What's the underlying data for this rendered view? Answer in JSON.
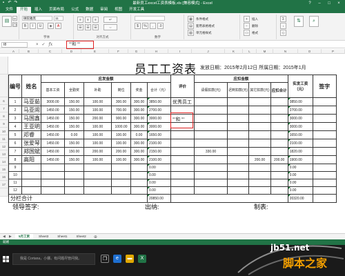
{
  "window": {
    "title": "最新员工excel工资表模板.xls [兼容模式] - Excel"
  },
  "ribbon_tabs": [
    "文件",
    "开始",
    "插入",
    "页面布局",
    "公式",
    "数据",
    "审阅",
    "视图",
    "开发工具"
  ],
  "active_tab": "开始",
  "ribbon": {
    "font_name": "微软雅黑",
    "font_size": "11",
    "group_font": "字体",
    "group_align": "对齐方式",
    "group_number": "数字",
    "group_styles": "样式",
    "group_cells": "单元格",
    "group_edit": "编辑",
    "cond_format": "条件格式",
    "table_format": "套用表格格式",
    "cell_styles": "单元格样式",
    "insert": "插入",
    "delete": "删除",
    "format": "格式"
  },
  "formula_bar": {
    "name_box": "I8",
    "cancel_icon": "×",
    "enter_icon": "✓",
    "fx": "fx",
    "content": "\"\"和 \"\""
  },
  "columns": [
    "A",
    "B",
    "C",
    "D",
    "E",
    "F",
    "G",
    "H",
    "I",
    "J",
    "K",
    "L",
    "M",
    "N",
    "O",
    "P"
  ],
  "sheet": {
    "title": "员工工资表",
    "date_line": "发放日期：2015年2月12日  所属日期：2015年1月",
    "headers": {
      "no": "编号",
      "name": "姓名",
      "payable": "应发金额",
      "base": "基本工资",
      "attendance": "全勤奖",
      "subsidy": "补助",
      "post": "岗位",
      "bonus": "奖金",
      "total": "合计（元）",
      "review": "评价",
      "deduct": "应扣金额",
      "leave": "请假扣款(元)",
      "late": "迟到扣款(元)",
      "other": "其它扣款(元)",
      "deduct_total": "应扣合计",
      "actual": "实发工资（元）",
      "sign": "签字"
    },
    "rows": [
      {
        "row": "6",
        "no": "1",
        "name": "马亚茹",
        "base": "3000.00",
        "att": "150.00",
        "sub": "100.00",
        "post": "300.00",
        "bonus": "300.00",
        "total": "3850.00",
        "review": "优秀员工",
        "leave": "",
        "late": "",
        "other": "",
        "dt": "",
        "actual": "3850.00"
      },
      {
        "row": "7",
        "no": "2",
        "name": "马亚闹",
        "base": "1450.00",
        "att": "150.00",
        "sub": "100.00",
        "post": "700.00",
        "bonus": "300.00",
        "total": "2700.00",
        "review": "",
        "leave": "",
        "late": "",
        "other": "",
        "dt": "",
        "actual": "2700.00"
      },
      {
        "row": "8",
        "no": "3",
        "name": "马国鑫",
        "base": "1450.00",
        "att": "150.00",
        "sub": "200.00",
        "post": "900.00",
        "bonus": "300.00",
        "total": "3000.00",
        "review": "\"\"和 \"\"",
        "leave": "",
        "late": "",
        "other": "",
        "dt": "",
        "actual": "3000.00"
      },
      {
        "row": "9",
        "no": "4",
        "name": "王亚明",
        "base": "1450.00",
        "att": "150.00",
        "sub": "100.00",
        "post": "1000.00",
        "bonus": "300.00",
        "total": "3000.00",
        "review": "",
        "leave": "",
        "late": "",
        "other": "",
        "dt": "",
        "actual": "3000.00"
      },
      {
        "row": "10",
        "no": "5",
        "name": "邓睿",
        "base": "1450.00",
        "att": "0.00",
        "sub": "100.00",
        "post": "100.00",
        "bonus": "0.00",
        "total": "1650.00",
        "review": "",
        "leave": "",
        "late": "",
        "other": "",
        "dt": "",
        "actual": "1650.00"
      },
      {
        "row": "11",
        "no": "6",
        "name": "张爱琴",
        "base": "1450.00",
        "att": "150.00",
        "sub": "100.00",
        "post": "100.00",
        "bonus": "300.00",
        "total": "2100.00",
        "review": "",
        "leave": "",
        "late": "",
        "other": "",
        "dt": "",
        "actual": "2100.00"
      },
      {
        "row": "12",
        "no": "7",
        "name": "郑国斌",
        "base": "1450.00",
        "att": "150.00",
        "sub": "200.00",
        "post": "200.00",
        "bonus": "300.00",
        "total": "2150.00",
        "review": "",
        "leave": "330.00",
        "late": "",
        "other": "",
        "dt": "",
        "actual": "1820.00"
      },
      {
        "row": "13",
        "no": "8",
        "name": "高阳",
        "base": "1450.00",
        "att": "150.00",
        "sub": "100.00",
        "post": "100.00",
        "bonus": "300.00",
        "total": "2100.00",
        "review": "",
        "leave": "",
        "late": "",
        "other": "200.00",
        "dt": "200.00",
        "actual": "1900.00"
      },
      {
        "row": "14",
        "no": "9",
        "name": "",
        "base": "",
        "att": "",
        "sub": "",
        "post": "",
        "bonus": "",
        "total": "0.00",
        "review": "",
        "leave": "",
        "late": "",
        "other": "",
        "dt": "",
        "actual": "0.00"
      },
      {
        "row": "15",
        "no": "10",
        "name": "",
        "base": "",
        "att": "",
        "sub": "",
        "post": "",
        "bonus": "",
        "total": "0.00",
        "review": "",
        "leave": "",
        "late": "",
        "other": "",
        "dt": "",
        "actual": "0.00"
      },
      {
        "row": "16",
        "no": "11",
        "name": "",
        "base": "",
        "att": "",
        "sub": "",
        "post": "",
        "bonus": "",
        "total": "0.00",
        "review": "",
        "leave": "",
        "late": "",
        "other": "",
        "dt": "",
        "actual": "0.00"
      },
      {
        "row": "17",
        "no": "12",
        "name": "",
        "base": "",
        "att": "",
        "sub": "",
        "post": "",
        "bonus": "",
        "total": "0.00",
        "review": "",
        "leave": "",
        "late": "",
        "other": "",
        "dt": "",
        "actual": "0.00"
      }
    ],
    "summary_label": "分栏合计",
    "summary_total": "20850.00",
    "summary_actual": "20320.00",
    "sign_leader": "领导签字:",
    "sign_cashier": "出纳:",
    "sign_maker": "制表:"
  },
  "sheet_tabs": [
    "5月工资",
    "Sheet3",
    "Sheet1",
    "Sheet2"
  ],
  "active_sheet": "5月工资",
  "status": "就绪",
  "taskbar": {
    "search_placeholder": "我是 Cortana，小娜。有问题尽管问我。"
  },
  "watermark": {
    "site": "jb51.net",
    "brand": "脚本之家"
  },
  "colors": {
    "excel_green": "#217346",
    "highlight_red": "#e02020",
    "watermark_orange": "#f5a000"
  }
}
